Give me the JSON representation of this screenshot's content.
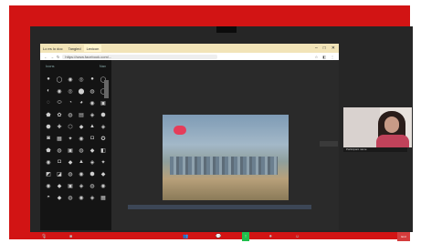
{
  "browser": {
    "tabs": [
      "Lo es lo doc",
      "Tangled",
      "Lexicon"
    ],
    "window_controls": [
      "–",
      "□",
      "✕"
    ],
    "url": "https://www.facebook.com/..."
  },
  "panel": {
    "header_left": "Icons",
    "header_right": "Nav",
    "icons": [
      "●",
      "◯",
      "◉",
      "◎",
      "●",
      "◯",
      "◐",
      "◉",
      "◎",
      "⬤",
      "◍",
      "◯",
      "◌",
      "⬭",
      "◔",
      "◕",
      "◉",
      "▣",
      "⬟",
      "✿",
      "◍",
      "▤",
      "◈",
      "⬢",
      "⬣",
      "✚",
      "⬡",
      "◆",
      "▲",
      "◈",
      "◙",
      "▦",
      "✦",
      "◉",
      "◘",
      "✪",
      "⬟",
      "◍",
      "▣",
      "◍",
      "◆",
      "◧",
      "◉",
      "◘",
      "◆",
      "▲",
      "◈",
      "✦",
      "◩",
      "◪",
      "◍",
      "◉",
      "⬢",
      "◆",
      "◉",
      "◆",
      "▣",
      "◈",
      "◍",
      "◉",
      "◓",
      "◆",
      "◍",
      "◉",
      "◈",
      "▦"
    ]
  },
  "participant": {
    "name_label": "Participant name"
  },
  "toolbar": {
    "mute_icon": "microphone-icon",
    "video_icon": "camera-icon",
    "participants_icon": "people-icon",
    "chat_icon": "chat-icon",
    "share_icon": "share-screen-icon",
    "record_icon": "record-icon",
    "reactions_icon": "reactions-icon",
    "end_label": "End"
  }
}
